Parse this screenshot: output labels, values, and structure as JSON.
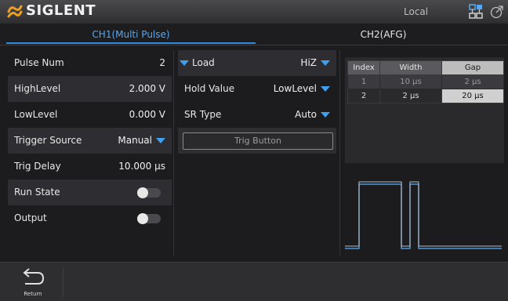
{
  "header": {
    "brand": "SIGLENT",
    "status": "Local"
  },
  "tabs": [
    {
      "label": "CH1(Multi Pulse)",
      "active": true
    },
    {
      "label": "CH2(AFG)",
      "active": false
    }
  ],
  "col1": {
    "pulse_num": {
      "label": "Pulse Num",
      "value": "2"
    },
    "high_level": {
      "label": "HighLevel",
      "value": "2.000 V"
    },
    "low_level": {
      "label": "LowLevel",
      "value": "0.000 V"
    },
    "trigger_source": {
      "label": "Trigger Source",
      "value": "Manual"
    },
    "trig_delay": {
      "label": "Trig Delay",
      "value": "10.000 μs"
    },
    "run_state": {
      "label": "Run State",
      "on": false
    },
    "output": {
      "label": "Output",
      "on": false
    }
  },
  "col2": {
    "load": {
      "label": "Load",
      "value": "HiZ"
    },
    "hold_value": {
      "label": "Hold Value",
      "value": "LowLevel"
    },
    "sr_type": {
      "label": "SR Type",
      "value": "Auto"
    },
    "trig_button": "Trig Button"
  },
  "pulse_table": {
    "headers": [
      "Index",
      "Width",
      "Gap"
    ],
    "rows": [
      [
        "1",
        "10 μs",
        "2 μs"
      ],
      [
        "2",
        "2 μs",
        "20 μs"
      ]
    ]
  },
  "bottom": {
    "return_label": "Return"
  },
  "colors": {
    "accent": "#2d8be0",
    "background": "#1c1c1f"
  }
}
